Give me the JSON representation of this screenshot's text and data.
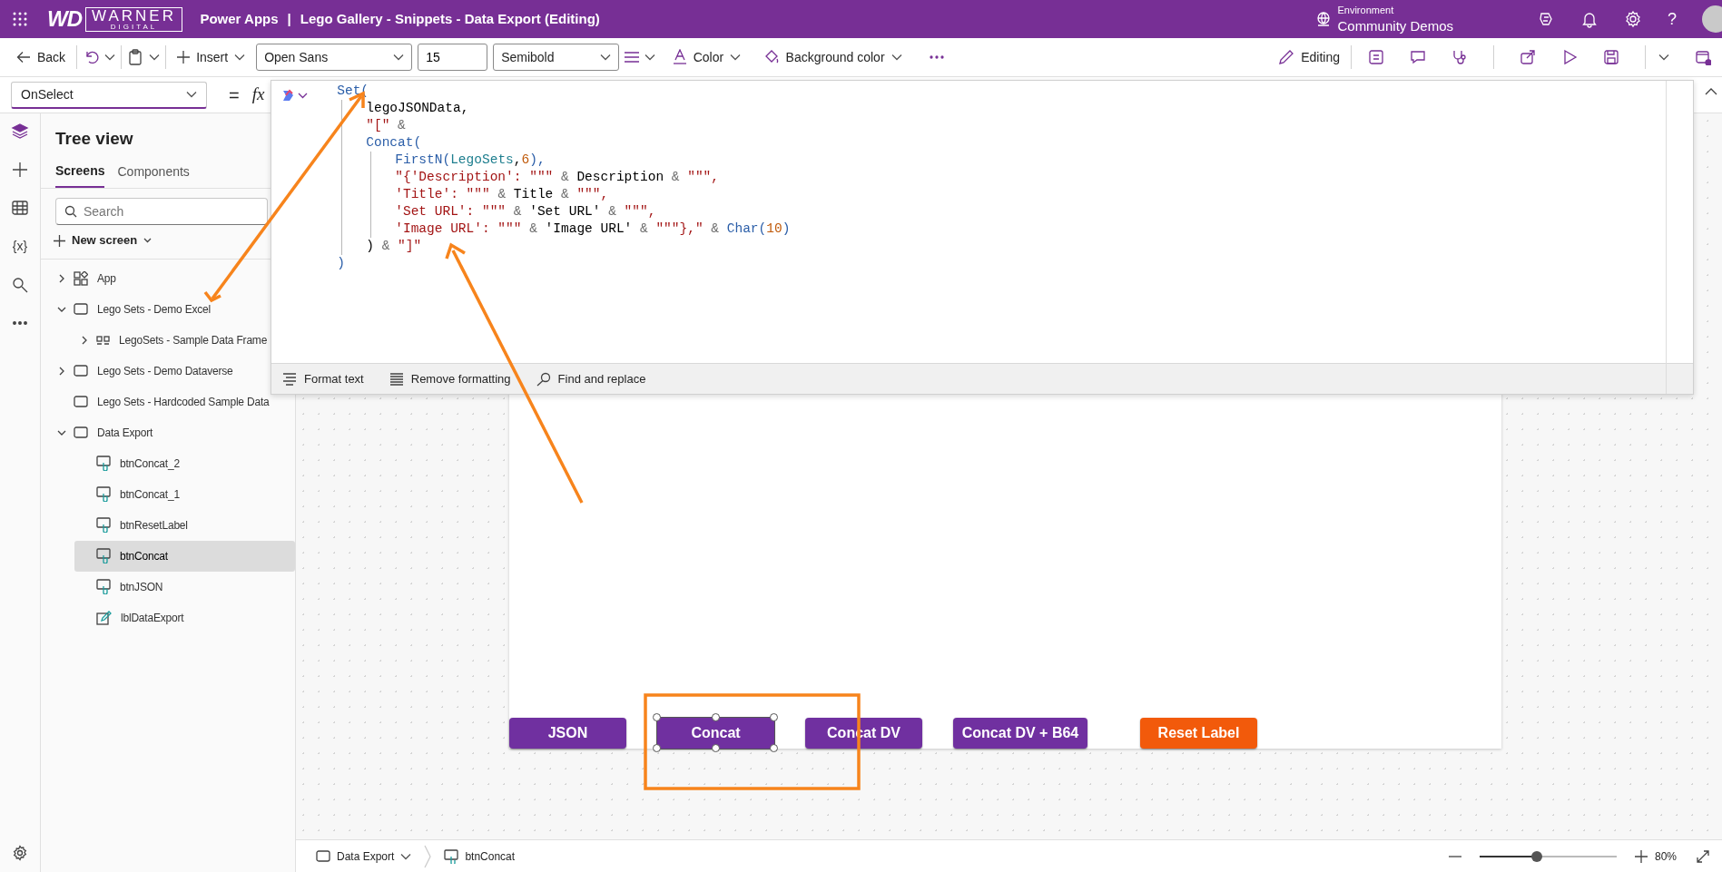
{
  "header": {
    "logo": {
      "mark": "WD",
      "name": "WARNER",
      "tagline": "DIGITAL"
    },
    "app_name": "Power Apps",
    "separator": "|",
    "document_title": "Lego Gallery - Snippets - Data Export (Editing)",
    "environment": {
      "label": "Environment",
      "name": "Community Demos"
    },
    "help": "?"
  },
  "toolbar": {
    "back": "Back",
    "insert": "Insert",
    "font": "Open Sans",
    "font_size": "15",
    "font_weight": "Semibold",
    "color_label": "Color",
    "background_color": "Background color",
    "editing": "Editing"
  },
  "formula_bar": {
    "property": "OnSelect",
    "equals": "=",
    "fx": "fx",
    "code": [
      {
        "tokens": [
          {
            "text": "Set(",
            "kind": "function"
          }
        ],
        "children": [
          {
            "tokens": [
              {
                "text": "legoJSONData,",
                "kind": "name"
              }
            ]
          },
          {
            "tokens": [
              {
                "text": "\"[\" ",
                "kind": "text"
              },
              {
                "text": "&",
                "kind": "operator"
              }
            ]
          },
          {
            "tokens": [
              {
                "text": "Concat(",
                "kind": "function"
              }
            ],
            "children": [
              {
                "tokens": [
                  {
                    "text": "FirstN(",
                    "kind": "function"
                  },
                  {
                    "text": "LegoSets",
                    "kind": "table"
                  },
                  {
                    "text": ",",
                    "kind": "name"
                  },
                  {
                    "text": "6",
                    "kind": "number"
                  },
                  {
                    "text": "),",
                    "kind": "function"
                  }
                ]
              },
              {
                "tokens": [
                  {
                    "text": "\"{'Description': \"\"\" ",
                    "kind": "text"
                  },
                  {
                    "text": "& ",
                    "kind": "operator"
                  },
                  {
                    "text": "Description ",
                    "kind": "name"
                  },
                  {
                    "text": "& ",
                    "kind": "operator"
                  },
                  {
                    "text": "\"\"\",",
                    "kind": "text"
                  }
                ]
              },
              {
                "tokens": [
                  {
                    "text": "'Title': \"\"\" ",
                    "kind": "text"
                  },
                  {
                    "text": "& ",
                    "kind": "operator"
                  },
                  {
                    "text": "Title ",
                    "kind": "name"
                  },
                  {
                    "text": "& ",
                    "kind": "operator"
                  },
                  {
                    "text": "\"\"\",",
                    "kind": "text"
                  }
                ]
              },
              {
                "tokens": [
                  {
                    "text": "'Set URL': \"\"\" ",
                    "kind": "text"
                  },
                  {
                    "text": "& ",
                    "kind": "operator"
                  },
                  {
                    "text": "'Set URL' ",
                    "kind": "name"
                  },
                  {
                    "text": "& ",
                    "kind": "operator"
                  },
                  {
                    "text": "\"\"\",",
                    "kind": "text"
                  }
                ]
              },
              {
                "tokens": [
                  {
                    "text": "'Image URL': \"\"\" ",
                    "kind": "text"
                  },
                  {
                    "text": "& ",
                    "kind": "operator"
                  },
                  {
                    "text": "'Image URL' ",
                    "kind": "name"
                  },
                  {
                    "text": "& ",
                    "kind": "operator"
                  },
                  {
                    "text": "\"\"\"},\" ",
                    "kind": "text"
                  },
                  {
                    "text": "& ",
                    "kind": "operator"
                  },
                  {
                    "text": "Char(",
                    "kind": "function"
                  },
                  {
                    "text": "10",
                    "kind": "number"
                  },
                  {
                    "text": ")",
                    "kind": "function"
                  }
                ]
              }
            ]
          },
          {
            "tokens": [
              {
                "text": ") ",
                "kind": "name"
              },
              {
                "text": "& ",
                "kind": "operator"
              },
              {
                "text": "\"]\"",
                "kind": "text"
              }
            ]
          }
        ]
      },
      {
        "tokens": [
          {
            "text": ")",
            "kind": "function"
          }
        ]
      }
    ],
    "actions": [
      {
        "label": "Format text",
        "kind": "format"
      },
      {
        "label": "Remove formatting",
        "kind": "remove"
      },
      {
        "label": "Find and replace",
        "kind": "find"
      }
    ]
  },
  "left_rail": {
    "items": [
      {
        "kind": "layers",
        "selected": true
      },
      {
        "kind": "insert",
        "selected": false
      },
      {
        "kind": "data",
        "selected": false
      },
      {
        "kind": "variables",
        "text": "{x}",
        "selected": false
      },
      {
        "kind": "search",
        "selected": false
      },
      {
        "kind": "more",
        "selected": false
      }
    ]
  },
  "tree_view": {
    "title": "Tree view",
    "tabs": [
      {
        "label": "Screens",
        "selected": true
      },
      {
        "label": "Components",
        "selected": false
      }
    ],
    "search_placeholder": "Search",
    "new_screen": "New screen",
    "items": [
      {
        "label": "App",
        "kind": "app",
        "expanded": false,
        "selected": false
      },
      {
        "label": "Lego Sets - Demo Excel",
        "kind": "screen",
        "expanded": true,
        "selected": false,
        "children": [
          {
            "label": "LegoSets - Sample Data Frame",
            "kind": "gallery",
            "expanded": false,
            "selected": false
          }
        ]
      },
      {
        "label": "Lego Sets - Demo Dataverse",
        "kind": "screen",
        "expanded": false,
        "selected": false
      },
      {
        "label": "Lego Sets - Hardcoded Sample Data",
        "kind": "screen",
        "selected": false
      },
      {
        "label": "Data Export",
        "kind": "screen",
        "expanded": true,
        "selected": false,
        "children": [
          {
            "label": "btnConcat_2",
            "kind": "button",
            "selected": false
          },
          {
            "label": "btnConcat_1",
            "kind": "button",
            "selected": false
          },
          {
            "label": "btnResetLabel",
            "kind": "button",
            "selected": false
          },
          {
            "label": "btnConcat",
            "kind": "button",
            "selected": true
          },
          {
            "label": "btnJSON",
            "kind": "button",
            "selected": false
          },
          {
            "label": "lblDataExport",
            "kind": "label",
            "selected": false
          }
        ]
      }
    ]
  },
  "canvas": {
    "buttons": [
      {
        "label": "JSON",
        "color": "#7030a0",
        "selected": false
      },
      {
        "label": "Concat",
        "color": "#7030a0",
        "selected": true
      },
      {
        "label": "Concat DV",
        "color": "#7030a0",
        "selected": false
      },
      {
        "label": "Concat DV + B64",
        "color": "#7030a0",
        "selected": false
      },
      {
        "label": "Reset Label",
        "color": "#f25a0b",
        "selected": false
      }
    ]
  },
  "status_bar": {
    "screen": "Data Export",
    "control": "btnConcat",
    "zoom": {
      "level": 0.42
    },
    "zoom_reading": "80%"
  }
}
